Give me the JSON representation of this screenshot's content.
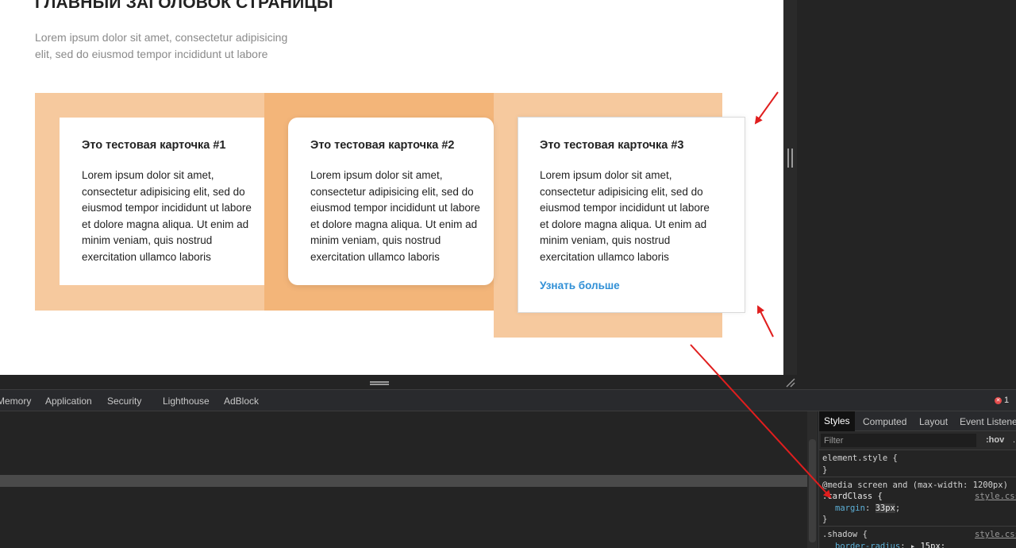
{
  "page": {
    "title": "ГЛАВНЫЙ ЗАГОЛОВОК СТРАНИЦЫ",
    "subtitle": "Lorem ipsum dolor sit amet, consectetur adipisicing elit, sed do eiusmod tempor incididunt ut labore"
  },
  "cards": [
    {
      "title": "Это тестовая карточка #1",
      "text": "Lorem ipsum dolor sit amet, consectetur adipisicing elit, sed do eiusmod tempor incididunt ut labore et dolore magna aliqua. Ut enim ad minim veniam, quis nostrud exercitation ullamco laboris"
    },
    {
      "title": "Это тестовая карточка #2",
      "text": "Lorem ipsum dolor sit amet, consectetur adipisicing elit, sed do eiusmod tempor incididunt ut labore et dolore magna aliqua. Ut enim ad minim veniam, quis nostrud exercitation ullamco laboris"
    },
    {
      "title": "Это тестовая карточка #3",
      "text": "Lorem ipsum dolor sit amet, consectetur adipisicing elit, sed do eiusmod tempor incididunt ut labore et dolore magna aliqua. Ut enim ad minim veniam, quis nostrud exercitation ullamco laboris",
      "link": "Узнать больше"
    }
  ],
  "devtools": {
    "tabs": [
      "Memory",
      "Application",
      "Security",
      "Lighthouse",
      "AdBlock"
    ],
    "error_count": "1",
    "styles_tabs": [
      "Styles",
      "Computed",
      "Layout",
      "Event Listeners"
    ],
    "filter_placeholder": "Filter",
    "hov_label": ":hov",
    "cls_label": ".",
    "rules": {
      "element_style_open": "element.style {",
      "close_brace": "}",
      "media_query": "@media screen and (max-width: 1200px)",
      "card_selector": ".cardClass {",
      "card_prop": "margin",
      "card_value": "33px",
      "card_source": "style.css",
      "shadow_selector": ".shadow {",
      "shadow_prop": "border-radius",
      "shadow_value": "15px;",
      "shadow_source": "style.css"
    }
  },
  "colors": {
    "margin_overlay": "#f6c99e",
    "margin_overlay_dark": "#f3b579",
    "link": "#2f8fd6",
    "annotation_arrow": "#e01e1e",
    "devtools_bg": "#202124"
  },
  "icons": {
    "error": "error-circle-icon",
    "annotation": "arrow-icon"
  }
}
